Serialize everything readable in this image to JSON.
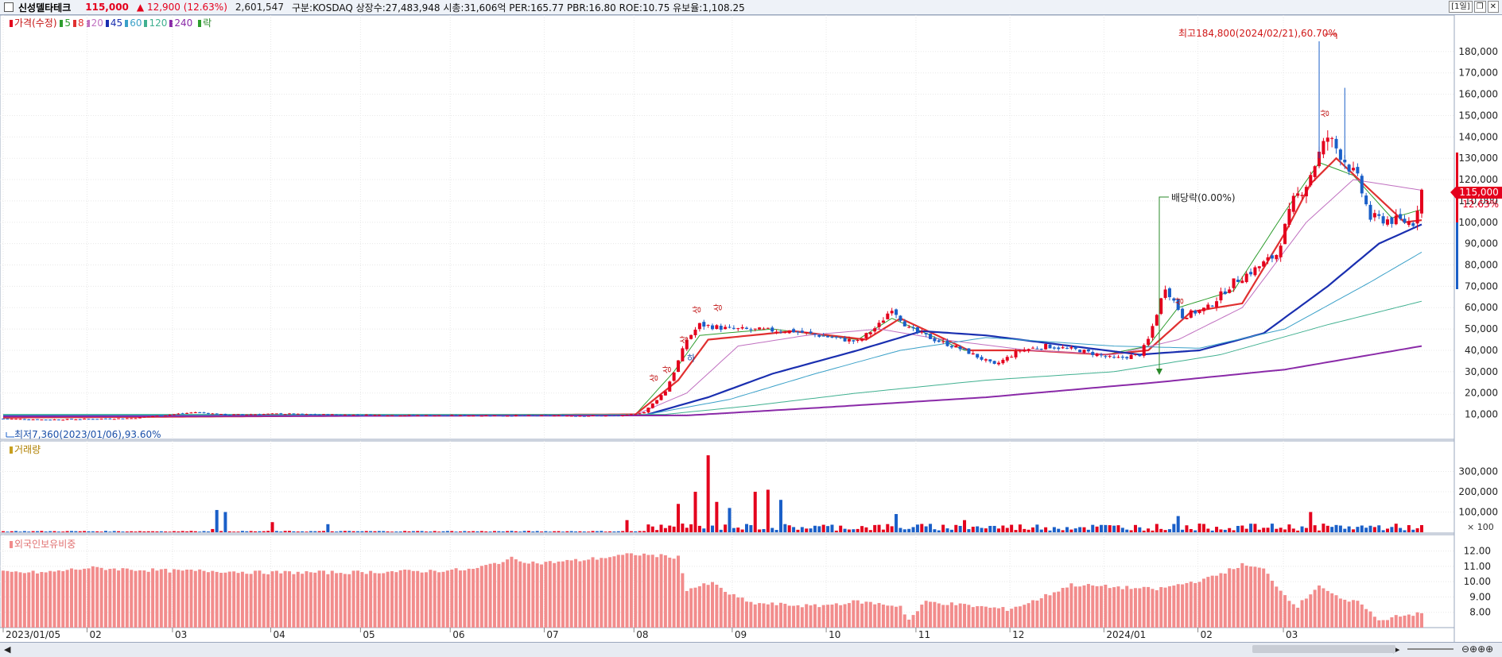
{
  "header": {
    "name": "신성델타테크",
    "price": "115,000",
    "change": "▲ 12,900 (12.63%)",
    "volume": "2,601,547",
    "info": "구분:KOSDAQ 상장수:27,483,948 시총:31,606억 PER:165.77 PBR:16.80 ROE:10.75 유보율:1,108.25",
    "period": "[1일]"
  },
  "price_legend": {
    "title": "가격(수정)",
    "ma": [
      {
        "label": "5",
        "color": "#2e9d2e"
      },
      {
        "label": "8",
        "color": "#e03030"
      },
      {
        "label": "20",
        "color": "#c070c0"
      },
      {
        "label": "45",
        "color": "#1a2fb0"
      },
      {
        "label": "60",
        "color": "#3aa0c8"
      },
      {
        "label": "120",
        "color": "#40b090"
      },
      {
        "label": "240",
        "color": "#8a2aa8"
      }
    ],
    "tail": "락"
  },
  "annotations": {
    "high": "최고184,800(2024/02/21),60.70%",
    "low": "최저7,360(2023/01/06),93.60%",
    "dividend": "배당락(0.00%)",
    "up_mark": "상",
    "down_mark": "하"
  },
  "price_badge": {
    "price": "115,000",
    "pct": "12.63%"
  },
  "volume_legend": "거래량",
  "foreign_legend": "외국인보유비중",
  "volume_axis_unit": "× 100",
  "colors": {
    "up": "#e4001d",
    "down": "#1a5fc8",
    "foreign": "#f28c8c",
    "grid": "#e8e8e8"
  },
  "chart_data": [
    {
      "type": "candlestick",
      "x_ticks": [
        "2023/01/05",
        "02",
        "03",
        "04",
        "05",
        "06",
        "07",
        "08",
        "09",
        "10",
        "11",
        "12",
        "2024/01",
        "02",
        "03"
      ],
      "ylim": [
        5000,
        190000
      ],
      "y_ticks": [
        "10,000",
        "20,000",
        "30,000",
        "40,000",
        "50,000",
        "60,000",
        "70,000",
        "80,000",
        "90,000",
        "100,000",
        "110,000",
        "120,000",
        "130,000",
        "140,000",
        "150,000",
        "160,000",
        "170,000",
        "180,000"
      ],
      "close_anchors": [
        [
          0,
          8000
        ],
        [
          10,
          7500
        ],
        [
          30,
          8200
        ],
        [
          45,
          11000
        ],
        [
          52,
          9800
        ],
        [
          65,
          10300
        ],
        [
          70,
          10000
        ],
        [
          100,
          9500
        ],
        [
          130,
          9400
        ],
        [
          145,
          9300
        ],
        [
          150,
          11000
        ],
        [
          155,
          21000
        ],
        [
          157,
          30000
        ],
        [
          160,
          45000
        ],
        [
          163,
          52000
        ],
        [
          170,
          50000
        ],
        [
          185,
          49000
        ],
        [
          200,
          44000
        ],
        [
          205,
          52000
        ],
        [
          208,
          60000
        ],
        [
          212,
          50000
        ],
        [
          218,
          45000
        ],
        [
          225,
          40000
        ],
        [
          232,
          33000
        ],
        [
          238,
          40000
        ],
        [
          244,
          42000
        ],
        [
          252,
          40000
        ],
        [
          260,
          36000
        ],
        [
          266,
          38000
        ],
        [
          268,
          45000
        ],
        [
          272,
          70000
        ],
        [
          276,
          56000
        ],
        [
          282,
          60000
        ],
        [
          288,
          72000
        ],
        [
          293,
          78000
        ],
        [
          298,
          85000
        ],
        [
          302,
          110000
        ],
        [
          305,
          118000
        ],
        [
          308,
          132000
        ],
        [
          310,
          140000
        ],
        [
          313,
          132000
        ],
        [
          317,
          120000
        ],
        [
          320,
          102000
        ],
        [
          325,
          101000
        ],
        [
          330,
          100000
        ],
        [
          332,
          115000
        ]
      ],
      "moving_averages": [
        {
          "name": "5",
          "anchors": [
            [
              0,
              8300
            ],
            [
              148,
              10000
            ],
            [
              157,
              30000
            ],
            [
              163,
              47000
            ],
            [
              180,
              50000
            ],
            [
              200,
              45000
            ],
            [
              208,
              55000
            ],
            [
              225,
              40000
            ],
            [
              240,
              40000
            ],
            [
              258,
              38000
            ],
            [
              268,
              42000
            ],
            [
              275,
              60000
            ],
            [
              288,
              68000
            ],
            [
              300,
              105000
            ],
            [
              308,
              128000
            ],
            [
              316,
              122000
            ],
            [
              325,
              102000
            ],
            [
              332,
              106000
            ]
          ]
        },
        {
          "name": "8",
          "anchors": [
            [
              0,
              8500
            ],
            [
              148,
              10000
            ],
            [
              158,
              26000
            ],
            [
              165,
              45000
            ],
            [
              185,
              49000
            ],
            [
              202,
              45000
            ],
            [
              210,
              55000
            ],
            [
              226,
              40000
            ],
            [
              240,
              40000
            ],
            [
              258,
              38000
            ],
            [
              268,
              40000
            ],
            [
              278,
              58000
            ],
            [
              290,
              62000
            ],
            [
              300,
              95000
            ],
            [
              306,
              118000
            ],
            [
              312,
              130000
            ],
            [
              320,
              115000
            ],
            [
              328,
              100000
            ],
            [
              332,
              101000
            ]
          ]
        },
        {
          "name": "20",
          "anchors": [
            [
              0,
              9200
            ],
            [
              148,
              9800
            ],
            [
              160,
              20000
            ],
            [
              172,
              42000
            ],
            [
              188,
              47000
            ],
            [
              205,
              50000
            ],
            [
              220,
              45000
            ],
            [
              240,
              40000
            ],
            [
              260,
              38000
            ],
            [
              275,
              45000
            ],
            [
              290,
              60000
            ],
            [
              305,
              100000
            ],
            [
              316,
              120000
            ],
            [
              332,
              115000
            ]
          ]
        },
        {
          "name": "45",
          "anchors": [
            [
              0,
              9500
            ],
            [
              150,
              9500
            ],
            [
              165,
              18000
            ],
            [
              180,
              29000
            ],
            [
              200,
              40000
            ],
            [
              215,
              49000
            ],
            [
              230,
              47000
            ],
            [
              250,
              42000
            ],
            [
              266,
              38000
            ],
            [
              280,
              40000
            ],
            [
              295,
              48000
            ],
            [
              310,
              70000
            ],
            [
              322,
              90000
            ],
            [
              332,
              99000
            ]
          ]
        },
        {
          "name": "60",
          "anchors": [
            [
              0,
              9700
            ],
            [
              150,
              9700
            ],
            [
              170,
              17000
            ],
            [
              190,
              29000
            ],
            [
              210,
              40000
            ],
            [
              230,
              46000
            ],
            [
              260,
              42000
            ],
            [
              280,
              41000
            ],
            [
              300,
              50000
            ],
            [
              320,
              72000
            ],
            [
              332,
              86000
            ]
          ]
        },
        {
          "name": "120",
          "anchors": [
            [
              0,
              10000
            ],
            [
              155,
              10000
            ],
            [
              175,
              14000
            ],
            [
              200,
              20000
            ],
            [
              230,
              26000
            ],
            [
              260,
              30000
            ],
            [
              285,
              38000
            ],
            [
              310,
              52000
            ],
            [
              332,
              63000
            ]
          ]
        },
        {
          "name": "240",
          "anchors": [
            [
              0,
              9000
            ],
            [
              160,
              9500
            ],
            [
              190,
              13000
            ],
            [
              230,
              18000
            ],
            [
              270,
              25000
            ],
            [
              300,
              31000
            ],
            [
              332,
              42000
            ]
          ]
        }
      ]
    },
    {
      "type": "bar",
      "name": "거래량",
      "ylim": [
        0,
        400000
      ],
      "y_ticks": [
        "100,000",
        "200,000",
        "300,000"
      ],
      "peaks": [
        [
          45,
          5000
        ],
        [
          49,
          16000
        ],
        [
          50,
          110000
        ],
        [
          52,
          100000
        ],
        [
          63,
          50000
        ],
        [
          76,
          40000
        ],
        [
          146,
          60000
        ],
        [
          158,
          140000
        ],
        [
          162,
          200000
        ],
        [
          165,
          380000
        ],
        [
          167,
          150000
        ],
        [
          170,
          120000
        ],
        [
          176,
          200000
        ],
        [
          179,
          210000
        ],
        [
          182,
          160000
        ],
        [
          209,
          90000
        ],
        [
          225,
          60000
        ],
        [
          275,
          80000
        ],
        [
          306,
          100000
        ],
        [
          331,
          20000
        ]
      ]
    },
    {
      "type": "bar",
      "name": "외국인보유비중",
      "ylim": [
        7.0,
        12.6
      ],
      "y_ticks": [
        "8.00",
        "9.00",
        "10.00",
        "11.00",
        "12.00"
      ],
      "anchors": [
        [
          0,
          10.6
        ],
        [
          10,
          10.6
        ],
        [
          20,
          10.9
        ],
        [
          30,
          10.8
        ],
        [
          40,
          10.7
        ],
        [
          50,
          10.7
        ],
        [
          60,
          10.6
        ],
        [
          80,
          10.6
        ],
        [
          100,
          10.7
        ],
        [
          110,
          10.8
        ],
        [
          119,
          11.5
        ],
        [
          125,
          11.2
        ],
        [
          135,
          11.4
        ],
        [
          148,
          11.8
        ],
        [
          158,
          11.6
        ],
        [
          160,
          9.5
        ],
        [
          166,
          9.9
        ],
        [
          170,
          9.2
        ],
        [
          175,
          8.6
        ],
        [
          190,
          8.4
        ],
        [
          200,
          8.7
        ],
        [
          210,
          8.4
        ],
        [
          212,
          7.5
        ],
        [
          216,
          8.7
        ],
        [
          235,
          8.2
        ],
        [
          240,
          8.6
        ],
        [
          250,
          9.8
        ],
        [
          270,
          9.5
        ],
        [
          282,
          10.2
        ],
        [
          290,
          11.1
        ],
        [
          295,
          10.8
        ],
        [
          300,
          9.1
        ],
        [
          303,
          8.4
        ],
        [
          308,
          9.8
        ],
        [
          313,
          8.8
        ],
        [
          318,
          8.6
        ],
        [
          322,
          7.4
        ],
        [
          326,
          7.8
        ],
        [
          332,
          7.9
        ]
      ]
    }
  ]
}
